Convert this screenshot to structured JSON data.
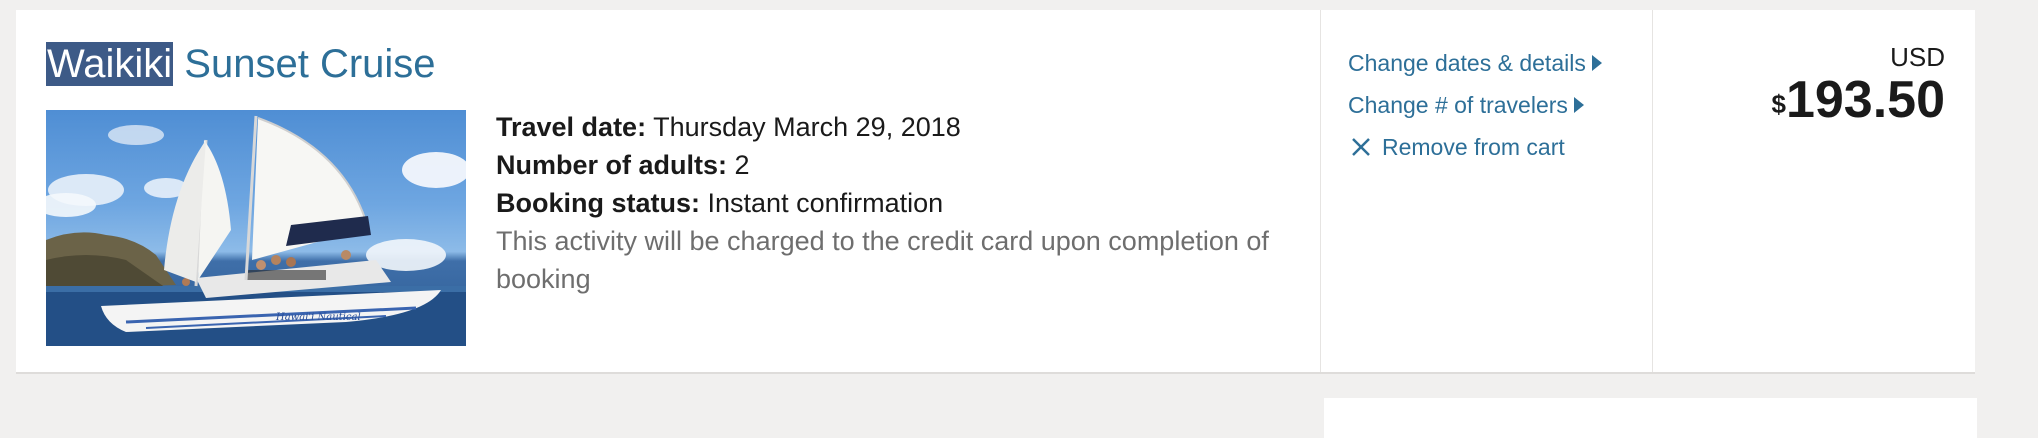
{
  "item": {
    "title_highlight": "Waikiki",
    "title_rest": " Sunset Cruise",
    "photo_alt": "Catamaran sailing",
    "details": {
      "travel_date_label": "Travel date:",
      "travel_date_value": " Thursday March 29, 2018",
      "adults_label": "Number of adults:",
      "adults_value": " 2",
      "status_label": "Booking status:",
      "status_value": " Instant confirmation",
      "note": "This activity will be charged to the credit card upon completion of booking"
    },
    "actions": {
      "change_dates": "Change dates & details",
      "change_travelers": "Change # of travelers",
      "remove": "Remove from cart"
    },
    "price": {
      "currency": "USD",
      "symbol": "$",
      "amount": "193.50"
    }
  },
  "colors": {
    "link": "#2d6f98",
    "highlight": "#3d5a87",
    "page_bg": "#f1f0ef"
  },
  "icons": {
    "change_dates": "triangle-right-icon",
    "change_travelers": "triangle-right-icon",
    "remove": "close-icon"
  }
}
